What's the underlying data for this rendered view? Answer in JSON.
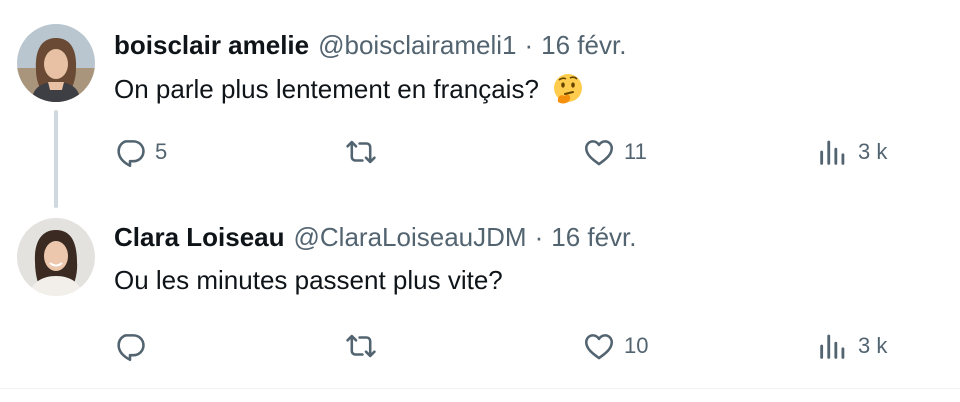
{
  "tweets": [
    {
      "name": "boisclair amelie",
      "handle": "@boisclairameli1",
      "separator": "·",
      "date": "16 févr.",
      "text": "On parle plus lentement en français?",
      "emoji": "thinking-face",
      "reply_count": "5",
      "retweet_count": "",
      "like_count": "11",
      "view_count": "3 k"
    },
    {
      "name": "Clara Loiseau",
      "handle": "@ClaraLoiseauJDM",
      "separator": "·",
      "date": "16 févr.",
      "text": "Ou les minutes passent plus vite?",
      "reply_count": "",
      "retweet_count": "",
      "like_count": "10",
      "view_count": "3 k"
    }
  ],
  "colors": {
    "text": "#0f1419",
    "muted": "#536471",
    "thread_line": "#cfd9de",
    "divider": "#eff3f4"
  },
  "icons": [
    "reply-icon",
    "retweet-icon",
    "like-icon",
    "views-icon",
    "thinking-face-emoji"
  ]
}
